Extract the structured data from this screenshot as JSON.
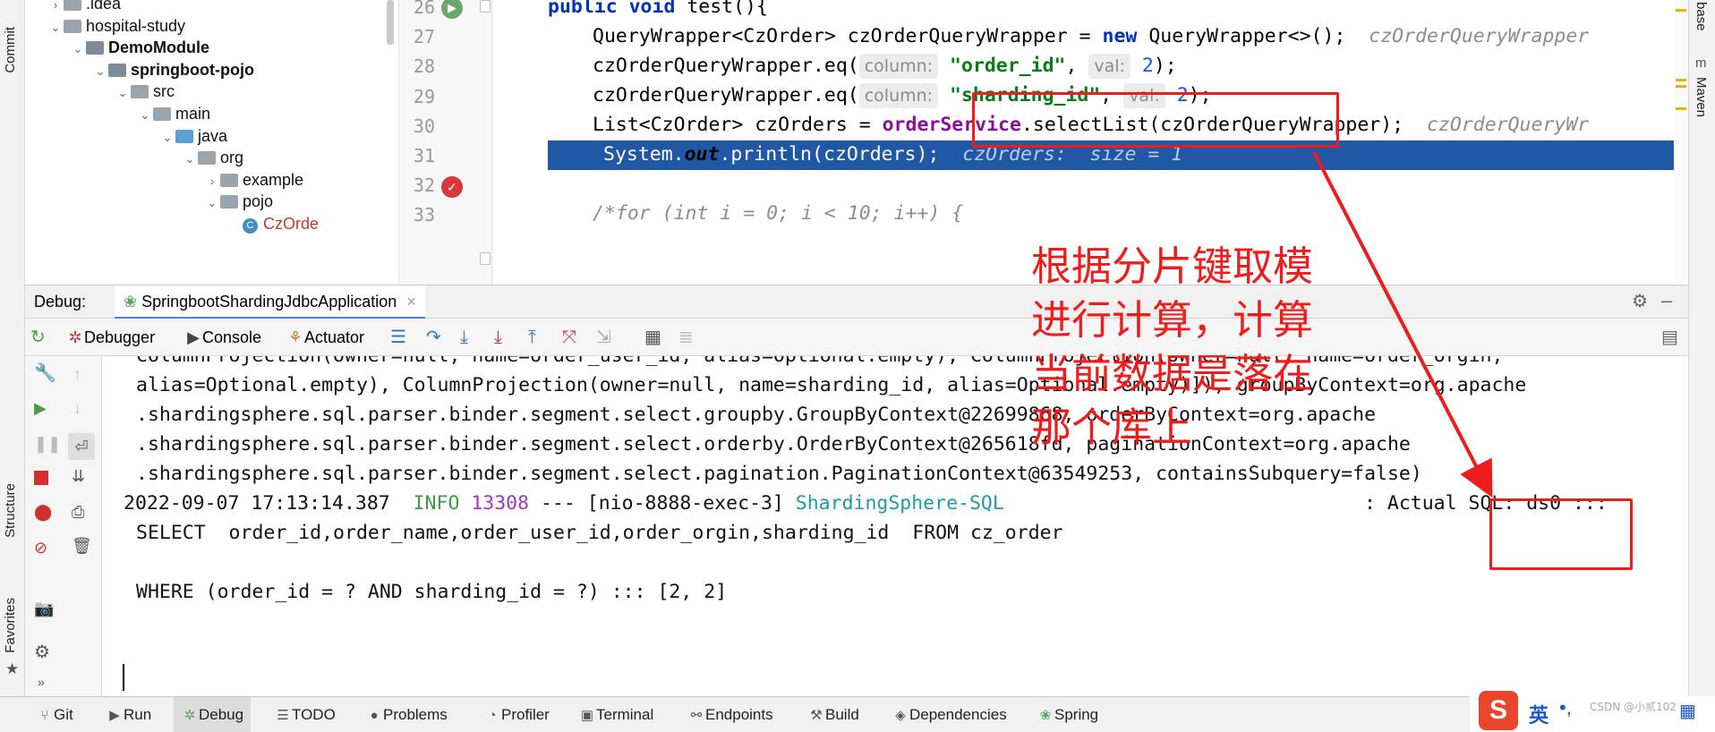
{
  "left_strip": {
    "top_label": "Commit",
    "mid_label": "Structure",
    "bottom_label": "Favorites"
  },
  "right_strip": {
    "top_label": "base",
    "mid_label": "Maven"
  },
  "tree": [
    {
      "indent": 1,
      "chev": ">",
      "kind": "folder",
      "label": ".idea"
    },
    {
      "indent": 1,
      "chev": "v",
      "kind": "folder",
      "label": "hospital-study"
    },
    {
      "indent": 2,
      "chev": "v",
      "kind": "module",
      "label": "DemoModule"
    },
    {
      "indent": 3,
      "chev": "v",
      "kind": "module",
      "label": "springboot-pojo"
    },
    {
      "indent": 4,
      "chev": "v",
      "kind": "folder",
      "label": "src"
    },
    {
      "indent": 5,
      "chev": "v",
      "kind": "folder",
      "label": "main"
    },
    {
      "indent": 6,
      "chev": "v",
      "kind": "folder-blue",
      "label": "java"
    },
    {
      "indent": 7,
      "chev": "v",
      "kind": "folder",
      "label": "org"
    },
    {
      "indent": 8,
      "chev": ">",
      "kind": "folder",
      "label": "example"
    },
    {
      "indent": 8,
      "chev": "v",
      "kind": "folder",
      "label": "pojo"
    },
    {
      "indent": 9,
      "chev": "",
      "kind": "class",
      "label": "CzOrde"
    }
  ],
  "editor": {
    "line_numbers": [
      "26",
      "27",
      "28",
      "29",
      "30",
      "31",
      "32",
      "33"
    ],
    "line26": {
      "kw": "public void",
      "rest": " test(){"
    },
    "line27": {
      "a": "QueryWrapper<CzOrder> czOrderQueryWrapper = ",
      "kw": "new",
      "b": " QueryWrapper<>();  ",
      "hint": "czOrderQueryWrapper"
    },
    "line28": {
      "a": "czOrderQueryWrapper.eq(",
      "h1": "column:",
      "s": "\"order_id\"",
      "c": ", ",
      "h2": "val:",
      "n": "2",
      "e": ");"
    },
    "line29": {
      "a": "czOrderQueryWrapper.eq(",
      "h1": "column:",
      "s": "\"sharding_id\"",
      "c": ", ",
      "h2": "val:",
      "n": "2",
      "e": ");"
    },
    "line30": {
      "a": "List<CzOrder> czOrders = ",
      "svc": "orderService",
      "b": ".selectList(czOrderQueryWrapper);  ",
      "hint": "czOrderQueryWr"
    },
    "line31": {
      "a": "System.",
      "out": "out",
      "b": ".println(czOrders);  ",
      "hint1": "czOrders:",
      "hint2": "size = 1"
    },
    "line33": {
      "cmt": "/*for (int i = 0; i < 10; i++) {"
    }
  },
  "debug": {
    "label": "Debug:",
    "tab": "SpringbootShardingJdbcApplication",
    "tabs": [
      "Debugger",
      "Console",
      "Actuator"
    ]
  },
  "console": {
    "line0": "ColumnProjection(owner=null, name=order_user_id, alias=Optional.empty), ColumnProjection(owner=null, name=order_orgin,",
    "line1": "alias=Optional.empty), ColumnProjection(owner=null, name=sharding_id, alias=Optional.empty)]), groupByContext=org.apache",
    "line2": ".shardingsphere.sql.parser.binder.segment.select.groupby.GroupByContext@22699868, orderByContext=org.apache",
    "line3": ".shardingsphere.sql.parser.binder.segment.select.orderby.OrderByContext@265618fd, paginationContext=org.apache",
    "line4": ".shardingsphere.sql.parser.binder.segment.select.pagination.PaginationContext@63549253, containsSubquery=false)",
    "log": {
      "time": "2022-09-07 17:13:14.387  ",
      "level": "INFO",
      "pid": "13308",
      "thread": " --- [nio-8888-exec-3] ",
      "logger": "ShardingSphere-SQL",
      "msg": ": Actual SQL: ds0 :::"
    },
    "line6": "SELECT  order_id,order_name,order_user_id,order_orgin,sharding_id  FROM cz_order",
    "line7": "WHERE (order_id = ? AND sharding_id = ?) ::: [2, 2]"
  },
  "annotation": {
    "text": "根据分片键取模进行计算，计算当前数据是落在那个库上",
    "color": "#ee1c1c"
  },
  "bottom_tabs": [
    "Git",
    "Run",
    "Debug",
    "TODO",
    "Problems",
    "Profiler",
    "Terminal",
    "Endpoints",
    "Build",
    "Dependencies",
    "Spring"
  ],
  "ime": {
    "label": "英",
    "watermark": "CSDN @小贰102"
  }
}
